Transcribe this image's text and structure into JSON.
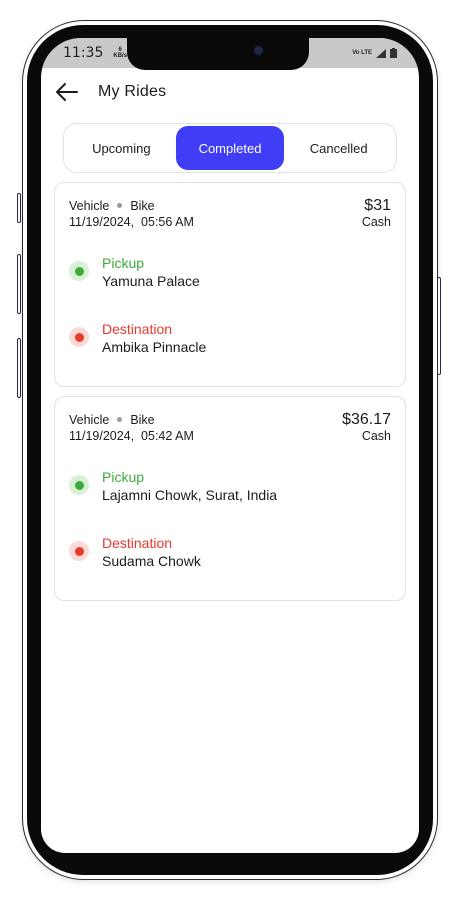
{
  "status_bar": {
    "time": "11:35",
    "speed": "6",
    "speed_unit": "KB/s",
    "network": "Vo LTE"
  },
  "header": {
    "title": "My Rides"
  },
  "tabs": [
    {
      "label": "Upcoming",
      "active": false
    },
    {
      "label": "Completed",
      "active": true
    },
    {
      "label": "Cancelled",
      "active": false
    }
  ],
  "rides": [
    {
      "vehicle_label": "Vehicle",
      "vehicle_type": "Bike",
      "datetime": "11/19/2024,  05:56 AM",
      "price": "$31",
      "payment": "Cash",
      "pickup_label": "Pickup",
      "pickup": "Yamuna Palace",
      "destination_label": "Destination",
      "destination": "Ambika Pinnacle"
    },
    {
      "vehicle_label": "Vehicle",
      "vehicle_type": "Bike",
      "datetime": "11/19/2024,  05:42 AM",
      "price": "$36.17",
      "payment": "Cash",
      "pickup_label": "Pickup",
      "pickup": "Lajamni Chowk, Surat, India",
      "destination_label": "Destination",
      "destination": "Sudama Chowk"
    }
  ],
  "colors": {
    "accent": "#3f3df5",
    "pickup": "#3cab3c",
    "destination": "#e8392e"
  }
}
